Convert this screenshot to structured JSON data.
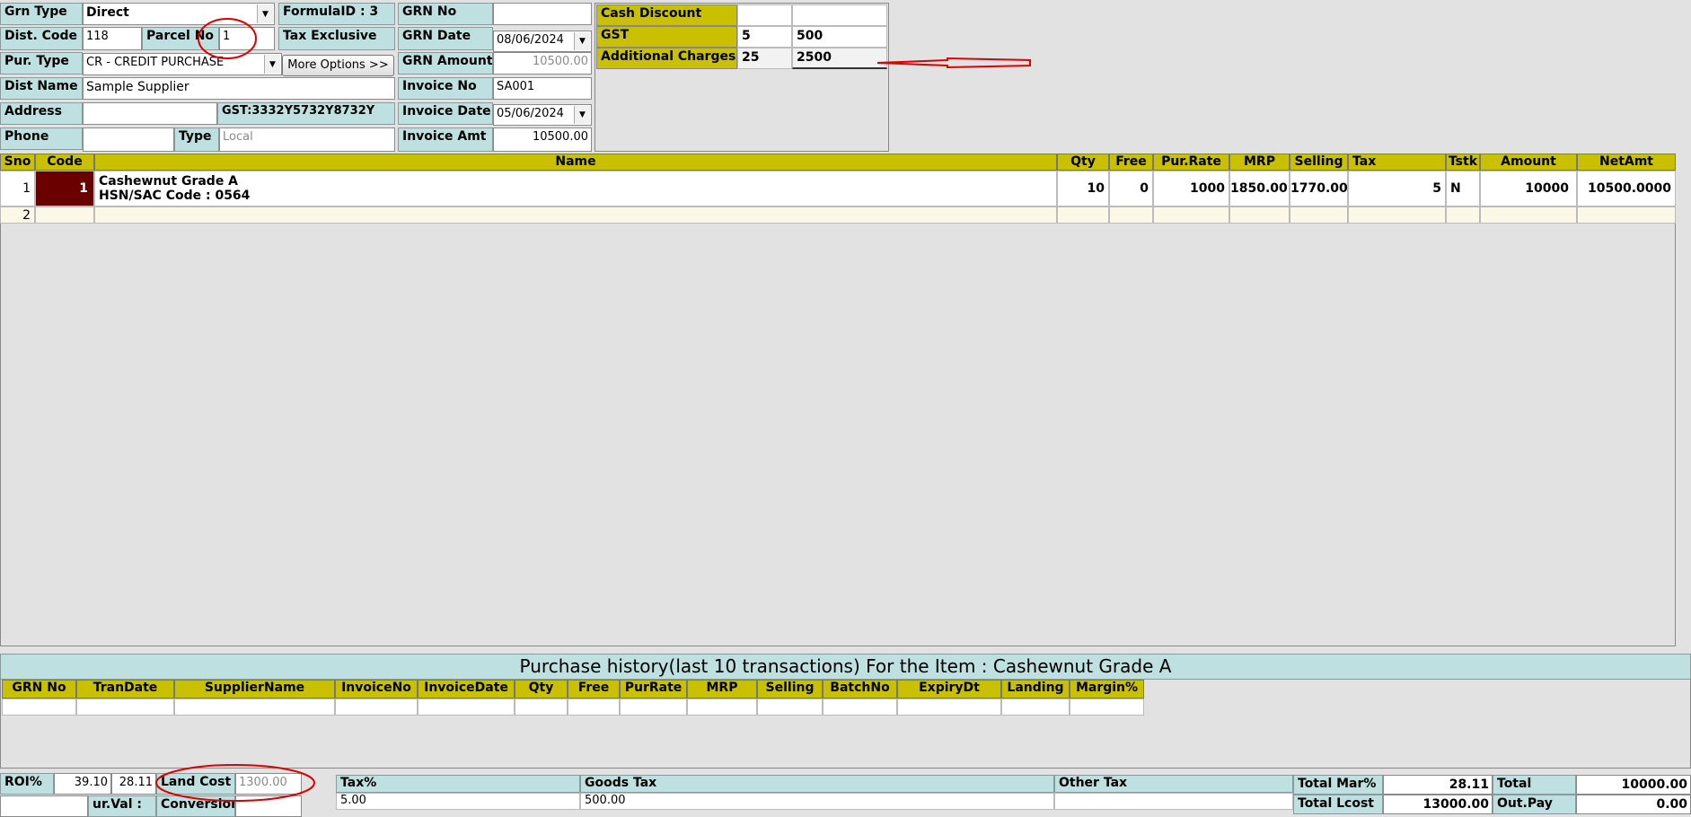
{
  "header": {
    "grn_type_label": "Grn Type",
    "grn_type_value": "Direct",
    "formula_id": "FormulaID : 3",
    "grn_no_label": "GRN No",
    "grn_no_value": "",
    "dist_code_label": "Dist. Code",
    "dist_code_value": "118",
    "parcel_no_label": "Parcel No",
    "parcel_no_value": "1",
    "tax_mode": "Tax Exclusive",
    "grn_date_label": "GRN Date",
    "grn_date_value": "08/06/2024",
    "pur_type_label": "Pur. Type",
    "pur_type_value": "CR - CREDIT PURCHASE",
    "more_options_label": "More Options >>",
    "grn_amount_label": "GRN Amount",
    "grn_amount_value": "10500.00",
    "dist_name_label": "Dist Name",
    "dist_name_value": "Sample Supplier",
    "invoice_no_label": "Invoice No",
    "invoice_no_value": "SA001",
    "address_label": "Address",
    "address_value": "",
    "gst_number": "GST:3332Y5732Y8732Y",
    "invoice_date_label": "Invoice Date",
    "invoice_date_value": "05/06/2024",
    "phone_label": "Phone",
    "phone_value": "",
    "type_label": "Type",
    "type_value": "Local",
    "invoice_amt_label": "Invoice Amt",
    "invoice_amt_value": "10500.00"
  },
  "charges": {
    "rows": [
      {
        "label": "Cash Discount",
        "v1": "",
        "v2": ""
      },
      {
        "label": "GST",
        "v1": "5",
        "v2": "500"
      },
      {
        "label": "Additional Charges",
        "v1": "25",
        "v2": "2500"
      }
    ]
  },
  "grid": {
    "columns": [
      "Sno",
      "Code",
      "Name",
      "Qty",
      "Free",
      "Pur.Rate",
      "MRP",
      "Selling",
      "Tax",
      "Tstk",
      "Amount",
      "NetAmt"
    ],
    "rows": [
      {
        "sno": "1",
        "code": "1",
        "name": "Cashewnut Grade A",
        "hsn": "HSN/SAC Code : 0564",
        "qty": "10",
        "free": "0",
        "pur_rate": "1000",
        "mrp": "1850.00",
        "selling": "1770.00",
        "tax": "5",
        "tstk": "N",
        "amount": "10000",
        "netamt": "10500.0000"
      },
      {
        "sno": "2"
      }
    ]
  },
  "history": {
    "title": "Purchase history(last 10 transactions)  For the Item : Cashewnut Grade A",
    "columns": [
      "GRN No",
      "TranDate",
      "SupplierName",
      "InvoiceNo",
      "InvoiceDate",
      "Qty",
      "Free",
      "PurRate",
      "MRP",
      "Selling",
      "BatchNo",
      "ExpiryDt",
      "Landing",
      "Margin%"
    ]
  },
  "footer": {
    "roi_label": "ROI%",
    "roi_value": "39.10",
    "margin_value": "28.11",
    "land_cost_label": "Land Cost",
    "land_cost_value": "1300.00",
    "pur_val_label": "ur.Val :",
    "conversion_label": "Conversion",
    "tax_columns": [
      "Tax%",
      "Goods Tax",
      "Other Tax"
    ],
    "tax_row": {
      "tax_pct": "5.00",
      "goods_tax": "500.00",
      "other_tax": ""
    },
    "total_mar_label": "Total Mar%",
    "total_mar_value": "28.11",
    "total_label": "Total",
    "total_value": "10000.00",
    "total_lcost_label": "Total Lcost",
    "total_lcost_value": "13000.00",
    "out_pay_label": "Out.Pay",
    "out_pay_value": "0.00"
  },
  "annotation_color": "#dd0000",
  "accent_colors": {
    "header_label_bg": "#bfe0e0",
    "grid_header_bg": "#c8c000",
    "code_cell_bg": "#6b0000"
  }
}
